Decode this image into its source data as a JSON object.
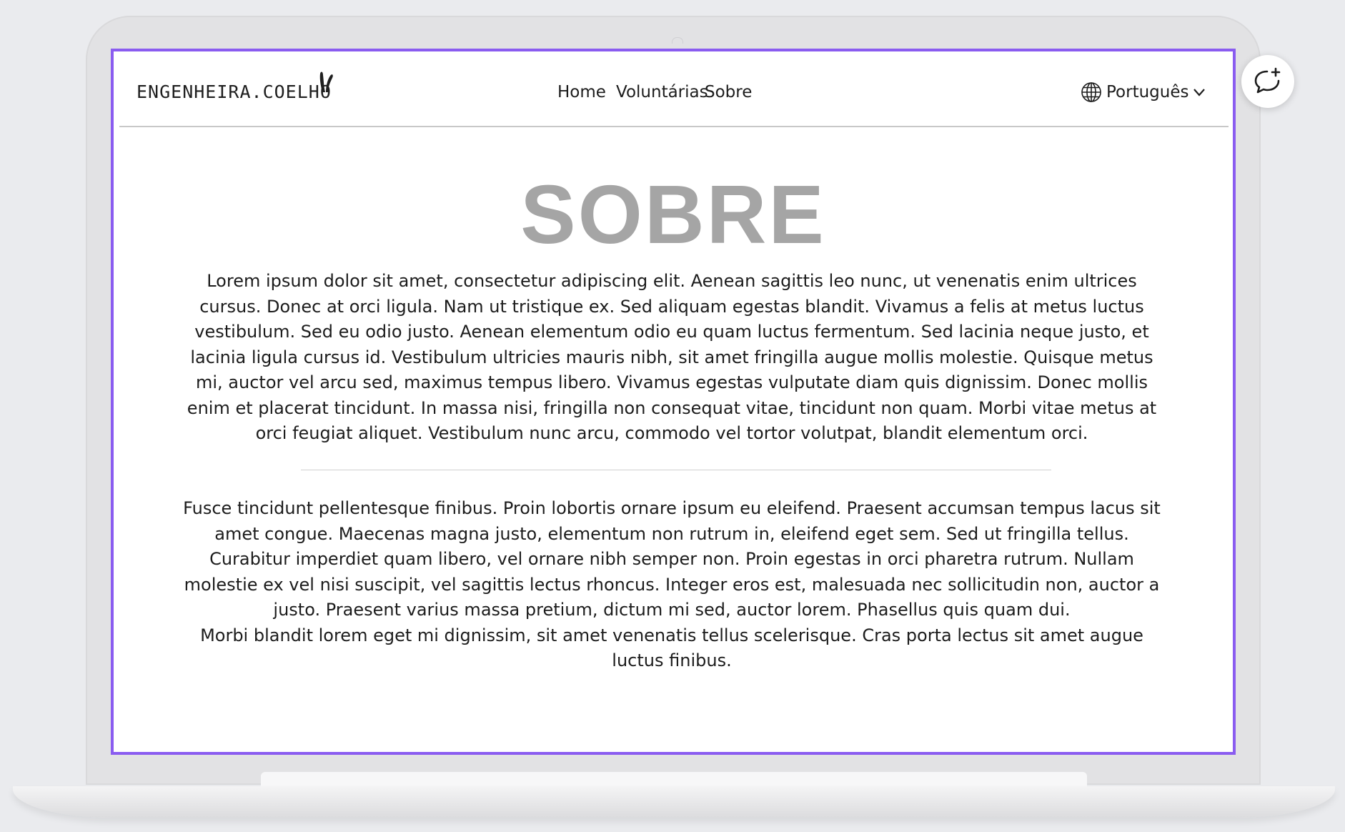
{
  "navbar": {
    "logo_text": "ENGENHEIRA.COELHO",
    "links": [
      "Home",
      "Voluntárias",
      "Sobre"
    ],
    "language": "Português"
  },
  "page": {
    "title": "SOBRE",
    "paragraph_1": "Lorem ipsum dolor sit amet, consectetur adipiscing elit. Aenean sagittis leo nunc, ut venenatis enim ultrices cursus. Donec at orci ligula. Nam ut tristique ex. Sed aliquam egestas blandit. Vivamus a felis at metus luctus vestibulum. Sed eu odio justo. Aenean elementum odio eu quam luctus fermentum. Sed lacinia neque justo, et lacinia ligula cursus id. Vestibulum ultricies mauris nibh, sit amet fringilla augue mollis molestie. Quisque metus mi, auctor vel arcu sed, maximus tempus libero. Vivamus egestas vulputate diam quis dignissim. Donec mollis enim et placerat tincidunt. In massa nisi, fringilla non consequat vitae, tincidunt non quam. Morbi vitae metus at orci feugiat aliquet. Vestibulum nunc arcu, commodo vel tortor volutpat, blandit elementum orci.",
    "paragraph_2": "Fusce tincidunt pellentesque finibus. Proin lobortis ornare ipsum eu eleifend. Praesent accumsan tempus lacus sit amet congue. Maecenas magna justo, elementum non rutrum in, eleifend eget sem. Sed ut fringilla tellus. Curabitur imperdiet quam libero, vel ornare nibh semper non. Proin egestas in orci pharetra rutrum. Nullam molestie ex vel nisi suscipit, vel sagittis lectus rhoncus. Integer eros est, malesuada nec sollicitudin non, auctor a justo. Praesent varius massa pretium, dictum mi sed, auctor lorem. Phasellus quis quam dui.",
    "paragraph_2b": "Morbi blandit lorem eget mi dignissim, sit amet venenatis tellus scelerisque. Cras porta lectus sit amet augue luctus finibus."
  },
  "icons": {
    "logo": "rabbit-ears-icon",
    "language": "globe-icon",
    "dropdown": "chevron-down-icon",
    "feedback": "chat-bubble-plus-icon"
  },
  "colors": {
    "screen_border": "#8a5cf0",
    "title": "#a5a5a5",
    "text": "#1c1c1c",
    "background": "#eaebee"
  }
}
